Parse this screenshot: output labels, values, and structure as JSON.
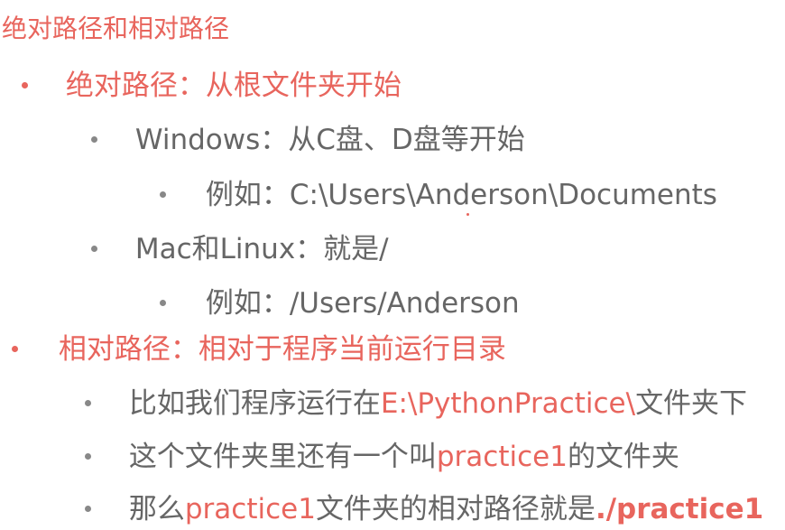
{
  "title": "绝对路径和相对路径",
  "absolute": {
    "heading": "绝对路径：从根文件夹开始",
    "windows": "Windows：从C盘、D盘等开始",
    "windows_example": "例如：C:\\Users\\Anderson\\Documents",
    "mac": "Mac和Linux：就是/",
    "mac_example": "例如：/Users/Anderson"
  },
  "relative": {
    "heading": "相对路径：相对于程序当前运行目录",
    "ex1_prefix": "比如我们程序运行在",
    "ex1_path": "E:\\PythonPractice\\",
    "ex1_suffix": "文件夹下",
    "ex2_prefix": "这个文件夹里还有一个叫",
    "ex2_name": "practice1",
    "ex2_suffix": "的文件夹",
    "ex3_prefix": "那么",
    "ex3_name": "practice1",
    "ex3_middle": "文件夹的相对路径就是",
    "ex3_path": "./practice1"
  },
  "colors": {
    "accent": "#e8655d",
    "text": "#666666",
    "bullet_gray": "#888888"
  }
}
